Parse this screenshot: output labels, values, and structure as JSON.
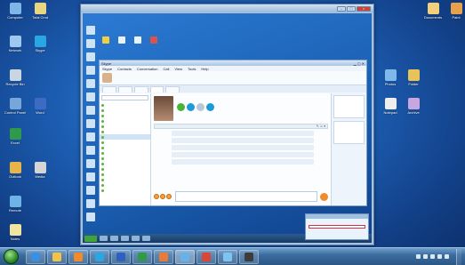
{
  "desktop": {
    "icons_left": [
      {
        "label": "Computer",
        "color": "#7fb6e8"
      },
      {
        "label": "Total Cmd",
        "color": "#e8d77f"
      },
      {
        "label": "Network",
        "color": "#9ec8f0"
      },
      {
        "label": "Skype",
        "color": "#2aa7e3"
      },
      {
        "label": "Recycle Bin",
        "color": "#c9d6e2"
      },
      {
        "label": "Control Panel",
        "color": "#77a7d8"
      },
      {
        "label": "Word",
        "color": "#3d6bc4"
      },
      {
        "label": "Excel",
        "color": "#2f9a4b"
      },
      {
        "label": "Outlook",
        "color": "#e8b44a"
      },
      {
        "label": "Media",
        "color": "#d5d5d5"
      },
      {
        "label": "Remote",
        "color": "#6fb3e6"
      },
      {
        "label": "Notes",
        "color": "#f0e6a0"
      }
    ],
    "icons_right": [
      {
        "label": "Documents",
        "color": "#f1d27a"
      },
      {
        "label": "Paint",
        "color": "#e7a04b"
      },
      {
        "label": "Photos",
        "color": "#7fb9ea"
      },
      {
        "label": "Folder",
        "color": "#e8c35a"
      },
      {
        "label": "Notepad",
        "color": "#eeeeee"
      },
      {
        "label": "Archive",
        "color": "#c8a6e0"
      }
    ]
  },
  "remote_window": {
    "title": "",
    "buttons": {
      "minimize": "–",
      "maximize": "□",
      "close": "×"
    }
  },
  "skype": {
    "window_title": "Skype",
    "menu": [
      "Skype",
      "Contacts",
      "Conversation",
      "Call",
      "View",
      "Tools",
      "Help"
    ],
    "user_name": "",
    "user_status": "",
    "balance_text": "",
    "tabs": [
      "",
      "",
      "",
      "",
      ""
    ],
    "search_placeholder": "",
    "contacts": [
      "",
      "",
      "",
      "",
      "",
      "",
      "",
      "",
      "",
      "",
      "",
      "",
      "",
      "",
      "",
      "",
      ""
    ],
    "chat_header": "",
    "messages": [
      {
        "who": "",
        "text": "",
        "time": ""
      },
      {
        "who": "",
        "text": "",
        "time": ""
      },
      {
        "who": "",
        "text": "",
        "time": ""
      },
      {
        "who": "",
        "text": "",
        "time": ""
      },
      {
        "who": "",
        "text": "",
        "time": ""
      }
    ]
  },
  "inner_taskbar": {
    "start_label": "",
    "clock": ""
  },
  "toast": {
    "header": "",
    "body": "",
    "alert": ""
  },
  "taskbar": {
    "apps": [
      {
        "name": "ie",
        "color": "#3b8fe0"
      },
      {
        "name": "explorer",
        "color": "#f0c34b"
      },
      {
        "name": "media",
        "color": "#f08a2a"
      },
      {
        "name": "skype",
        "color": "#2aa7e3"
      },
      {
        "name": "word",
        "color": "#2f5fbf"
      },
      {
        "name": "excel",
        "color": "#2e9a4a"
      },
      {
        "name": "paint",
        "color": "#e67b3a"
      },
      {
        "name": "rdp",
        "color": "#67b2e8"
      },
      {
        "name": "chrome",
        "color": "#d9473b"
      },
      {
        "name": "network",
        "color": "#7fc3f0"
      },
      {
        "name": "terminal",
        "color": "#3c3c3c"
      }
    ],
    "clock": ""
  }
}
